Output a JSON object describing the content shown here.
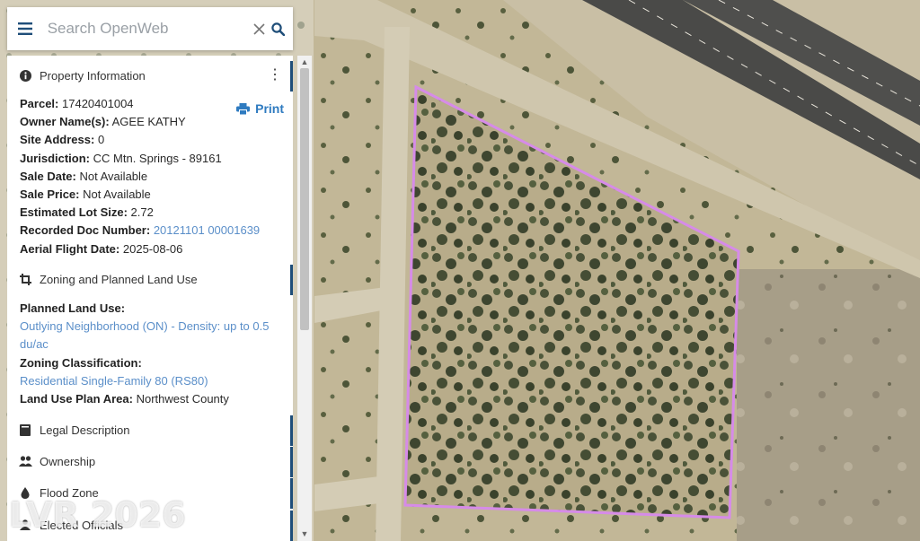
{
  "search": {
    "placeholder": "Search OpenWeb"
  },
  "panel": {
    "property_info": {
      "title": "Property Information",
      "print_label": "Print",
      "rows": [
        {
          "label": "Parcel:",
          "value": "17420401004"
        },
        {
          "label": "Owner Name(s):",
          "value": "AGEE KATHY"
        },
        {
          "label": "Site Address:",
          "value": "0"
        },
        {
          "label": "Jurisdiction:",
          "value": "CC Mtn. Springs - 89161"
        },
        {
          "label": "Sale Date:",
          "value": "Not Available"
        },
        {
          "label": "Sale Price:",
          "value": "Not Available"
        },
        {
          "label": "Estimated Lot Size:",
          "value": "2.72"
        },
        {
          "label": "Recorded Doc Number:",
          "value": "20121101 00001639"
        },
        {
          "label": "Aerial Flight Date:",
          "value": "2025-08-06"
        }
      ]
    },
    "zoning": {
      "title": "Zoning and Planned Land Use",
      "planned_land_use_label": "Planned Land Use:",
      "planned_land_use_line1": "Outlying Neighborhood (ON) - Density: up to 0.5",
      "planned_land_use_line2": "du/ac",
      "zoning_classification_label": "Zoning Classification:",
      "zoning_classification_value": "Residential Single-Family 80 (RS80)",
      "land_use_plan_area_label": "Land Use Plan Area:",
      "land_use_plan_area_value": "Northwest County"
    },
    "sections": {
      "legal_description": "Legal Description",
      "ownership": "Ownership",
      "flood_zone": "Flood Zone",
      "elected_officials": "Elected Officials"
    }
  },
  "watermark": "LVR 2026",
  "colors": {
    "parcel_outline": "#d68be8",
    "accent": "#1f4e79",
    "link": "#5b8fc9",
    "search_icon": "#1f4e79"
  }
}
